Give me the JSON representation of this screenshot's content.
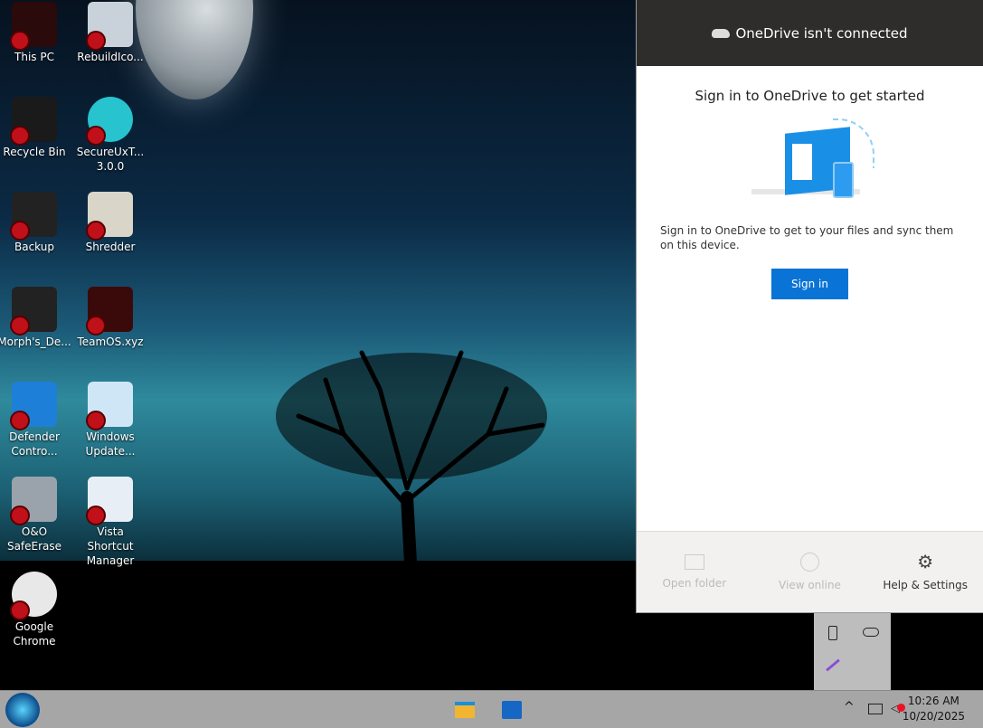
{
  "desktop": {
    "icons": [
      {
        "label": "This PC",
        "color": "#2a0a0a"
      },
      {
        "label": "RebuildIco...",
        "color": "#c9d2da"
      },
      {
        "label": "Recycle Bin",
        "color": "#1a1a1a"
      },
      {
        "label": "SecureUxT... 3.0.0",
        "color": "#27c3cf"
      },
      {
        "label": "Backup",
        "color": "#222"
      },
      {
        "label": "Shredder",
        "color": "#d9d5c8"
      },
      {
        "label": "Morph's_De...",
        "color": "#222"
      },
      {
        "label": "TeamOS.xyz",
        "color": "#3a0a0a"
      },
      {
        "label": "Defender Contro...",
        "color": "#1e7fd8"
      },
      {
        "label": "Windows Update...",
        "color": "#cfe6f7"
      },
      {
        "label": "O&O SafeErase",
        "color": "#9aa3ab"
      },
      {
        "label": "Vista Shortcut Manager",
        "color": "#e7eef5"
      },
      {
        "label": "Google Chrome",
        "color": "#e8e8e8"
      }
    ]
  },
  "onedrive": {
    "header": "OneDrive isn't connected",
    "title": "Sign in to OneDrive to get started",
    "description": "Sign in to OneDrive to get to your files and sync them on this device.",
    "signin": "Sign in",
    "footer": {
      "open_folder": "Open folder",
      "view_online": "View online",
      "help_settings": "Help & Settings"
    },
    "accent": "#0a73d6"
  },
  "taskbar": {
    "time": "10:26 AM",
    "date": "10/20/2025"
  }
}
